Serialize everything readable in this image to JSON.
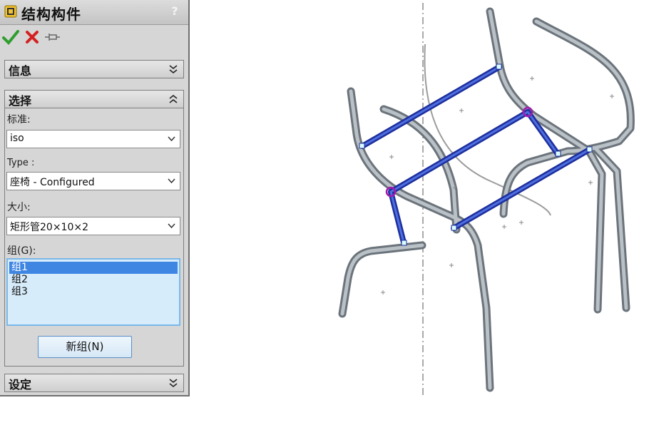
{
  "panel": {
    "title": "结构构件",
    "help": "?",
    "actions": {
      "ok_icon": "checkmark-icon",
      "cancel_icon": "x-icon",
      "pin_icon": "pushpin-icon"
    },
    "sections": {
      "info": {
        "label": "信息",
        "state": "collapsed"
      },
      "selection": {
        "label": "选择",
        "state": "expanded"
      },
      "settings": {
        "label": "设定",
        "state": "collapsed"
      }
    },
    "standard": {
      "label": "标准:",
      "value": "iso"
    },
    "type": {
      "label": "Type :",
      "value": "座椅 - Configured"
    },
    "size": {
      "label": "大小:",
      "value": "矩形管20×10×2"
    },
    "groups": {
      "label": "组(G):",
      "items": [
        "组1",
        "组2",
        "组3"
      ],
      "selected_index": 0
    },
    "new_group_button": "新组(N)"
  },
  "colors": {
    "selection_blue": "#3f86e3",
    "listbox_bg": "#d7ecfb",
    "frame_tube": "#8f979f",
    "structural_member": "#2d47c4"
  }
}
